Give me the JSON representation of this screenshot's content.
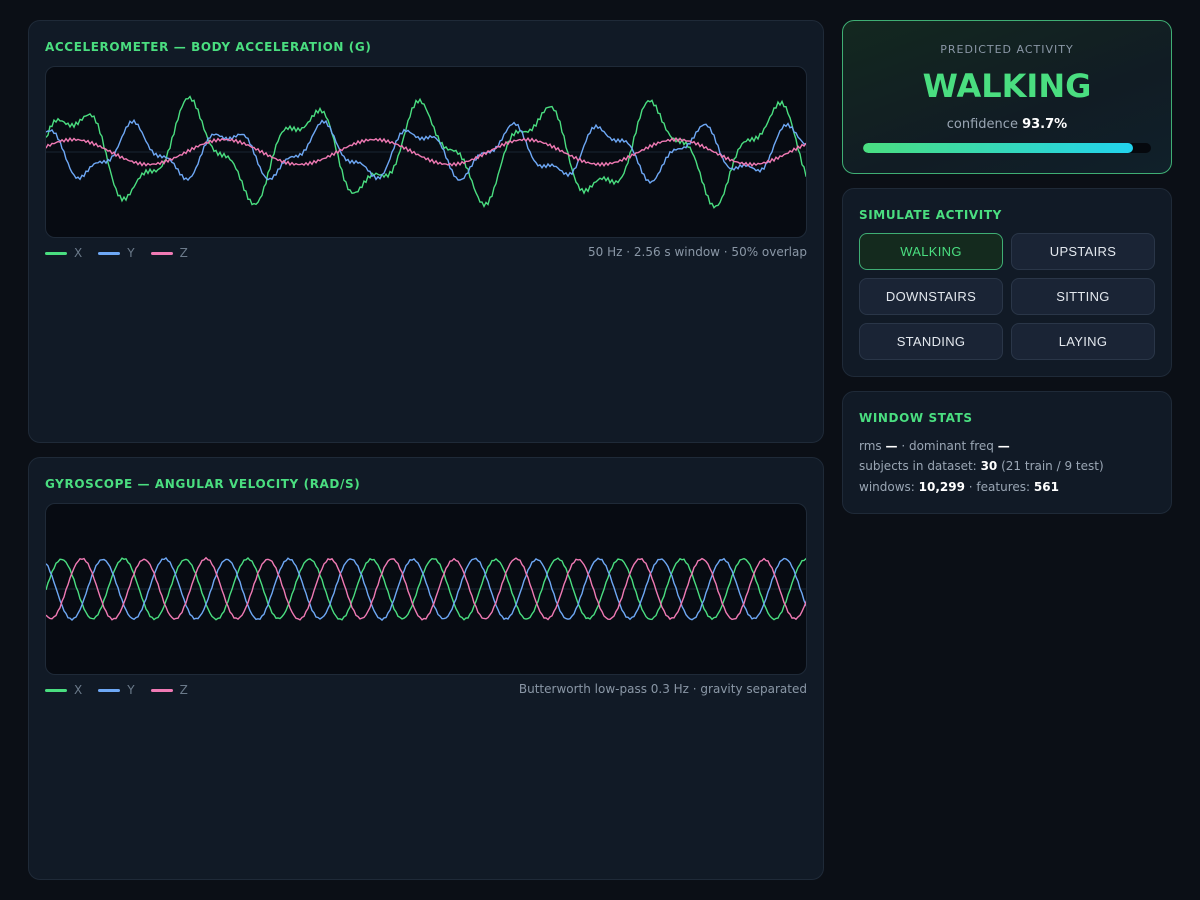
{
  "accelerometer": {
    "title": "ACCELEROMETER — BODY ACCELERATION (G)",
    "legend": [
      "X",
      "Y",
      "Z"
    ],
    "note": "50 Hz · 2.56 s window · 50% overlap"
  },
  "gyroscope": {
    "title": "GYROSCOPE — ANGULAR VELOCITY (RAD/S)",
    "legend": [
      "X",
      "Y",
      "Z"
    ],
    "note": "Butterworth low-pass 0.3 Hz · gravity separated"
  },
  "colors": {
    "x": "#4ade80",
    "y": "#6ea8f5",
    "z": "#f07ab4",
    "accent": "#4ade80"
  },
  "prediction": {
    "label": "PREDICTED ACTIVITY",
    "activity": "WALKING",
    "confidence_label": "confidence",
    "confidence_value": "93.7%",
    "confidence_fraction": 0.937
  },
  "simulate": {
    "title": "SIMULATE ACTIVITY",
    "buttons": [
      "WALKING",
      "UPSTAIRS",
      "DOWNSTAIRS",
      "SITTING",
      "STANDING",
      "LAYING"
    ],
    "active": "WALKING"
  },
  "stats": {
    "title": "WINDOW STATS",
    "rms_label": "rms",
    "rms_value": "—",
    "freq_label": "· dominant freq",
    "freq_value": "—",
    "subjects_label": "subjects in dataset:",
    "subjects_value": "30",
    "subjects_split": "(21 train / 9 test)",
    "windows_label": "windows:",
    "windows_value": "10,299",
    "features_label": "· features:",
    "features_value": "561"
  }
}
